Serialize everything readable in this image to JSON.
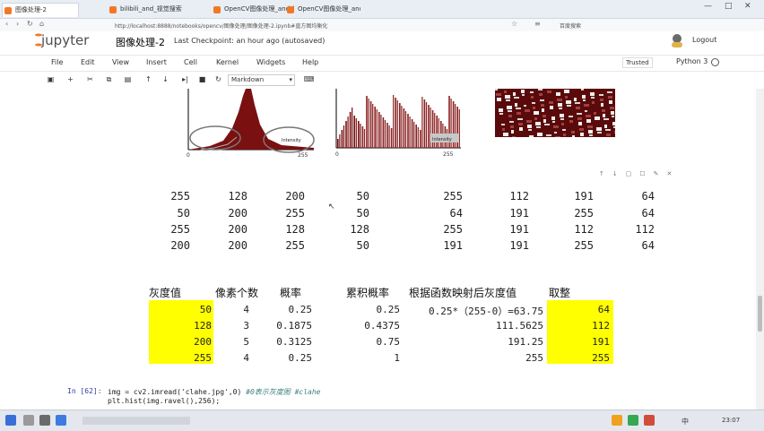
{
  "browser": {
    "tabs": [
      {
        "label": "图像处理-2",
        "active": true
      },
      {
        "label": "bilibili_and_视觉搜索",
        "active": false
      },
      {
        "label": "OpenCV图像处理_and_bilibili",
        "active": false
      },
      {
        "label": "OpenCV图像处理_and_bilibili",
        "active": false
      }
    ],
    "url": "http://localhost:8888/notebooks/opencv/图像处理/图像处理-2.ipynb#直方图均衡化",
    "search_label": "百度搜索"
  },
  "jupyter": {
    "logo_text": "jupyter",
    "notebook_title": "图像处理-2",
    "checkpoint": "Last Checkpoint: an hour ago (autosaved)",
    "logout": "Logout",
    "menu": [
      "File",
      "Edit",
      "View",
      "Insert",
      "Cell",
      "Kernel",
      "Widgets",
      "Help"
    ],
    "trusted": "Trusted",
    "kernel": "Python 3",
    "cell_type": "Markdown"
  },
  "plots": {
    "left_tick_start": "0",
    "left_tick_end": "255",
    "left_label": "Intensity",
    "mid_tick_start": "0",
    "mid_tick_end": "255",
    "mid_label": "Intensity"
  },
  "matrices": {
    "original": [
      [
        "255",
        "128",
        "200",
        "50"
      ],
      [
        "50",
        "200",
        "255",
        "50"
      ],
      [
        "255",
        "200",
        "128",
        "128"
      ],
      [
        "200",
        "200",
        "255",
        "50"
      ]
    ],
    "equalized": [
      [
        "255",
        "112",
        "191",
        "64"
      ],
      [
        "64",
        "191",
        "255",
        "64"
      ],
      [
        "255",
        "191",
        "112",
        "112"
      ],
      [
        "191",
        "191",
        "255",
        "64"
      ]
    ]
  },
  "table": {
    "headers": [
      "灰度值",
      "像素个数",
      "概率",
      "累积概率",
      "根据函数映射后灰度值",
      "取整"
    ],
    "rows": [
      [
        "50",
        "4",
        "0.25",
        "0.25",
        "0.25*（255-0）=63.75",
        "64"
      ],
      [
        "128",
        "3",
        "0.1875",
        "0.4375",
        "111.5625",
        "112"
      ],
      [
        "200",
        "5",
        "0.3125",
        "0.75",
        "191.25",
        "191"
      ],
      [
        "255",
        "4",
        "0.25",
        "1",
        "255",
        "255"
      ]
    ],
    "highlight_color": "#ffff00"
  },
  "code_cell": {
    "prompt": "In [62]:",
    "lines": [
      {
        "code": "img = cv2.imread('clahe.jpg',0) ",
        "comment": "#0表示灰度图 #clahe"
      },
      {
        "code": "plt.hist(img.ravel(),256);",
        "comment": ""
      }
    ]
  },
  "taskbar": {
    "ime": "中",
    "time": "23:07"
  }
}
